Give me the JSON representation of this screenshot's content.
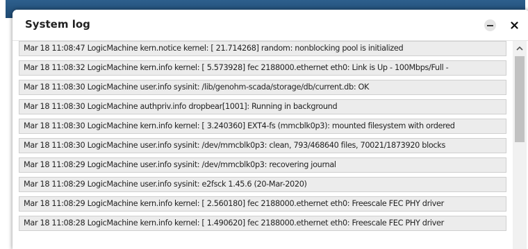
{
  "window": {
    "title": "System log",
    "minimize_icon": "minus-icon",
    "close_icon": "close-icon"
  },
  "log": {
    "entries": [
      "Mar 18 11:08:47 LogicMachine kern.notice kernel: [ 21.714268] random: nonblocking pool is initialized",
      "Mar 18 11:08:32 LogicMachine kern.info kernel: [ 5.573928] fec 2188000.ethernet eth0: Link is Up - 100Mbps/Full -",
      "Mar 18 11:08:30 LogicMachine user.info sysinit: /lib/genohm-scada/storage/db/current.db: OK",
      "Mar 18 11:08:30 LogicMachine authpriv.info dropbear[1001]: Running in background",
      "Mar 18 11:08:30 LogicMachine kern.info kernel: [ 3.240360] EXT4-fs (mmcblk0p3): mounted filesystem with ordered",
      "Mar 18 11:08:30 LogicMachine user.info sysinit: /dev/mmcblk0p3: clean, 793/468640 files, 70021/1873920 blocks",
      "Mar 18 11:08:29 LogicMachine user.info sysinit: /dev/mmcblk0p3: recovering journal",
      "Mar 18 11:08:29 LogicMachine user.info sysinit: e2fsck 1.45.6 (20-Mar-2020)",
      "Mar 18 11:08:29 LogicMachine kern.info kernel: [ 2.560180] fec 2188000.ethernet eth0: Freescale FEC PHY driver",
      "Mar 18 11:08:28 LogicMachine kern.info kernel: [ 1.490620] fec 2188000.ethernet eth0: Freescale FEC PHY driver"
    ]
  },
  "scrollbar": {
    "up_icon": "chevron-up-icon"
  },
  "colors": {
    "row_background": "#ececec",
    "row_border": "#cfcfcf",
    "header_backdrop": "#2d5f8d"
  }
}
